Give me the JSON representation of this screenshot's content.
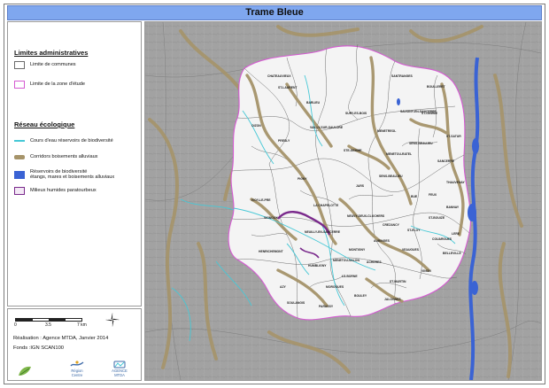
{
  "title": "Trame Bleue",
  "legend": {
    "admin_title": "Limites administratives",
    "admin_items": [
      {
        "label": "Limite de communes",
        "color": "#6b6b6b"
      },
      {
        "label": "Limite de la zone d'étude",
        "color": "#d55bd2"
      }
    ],
    "eco_title": "Réseau écologique",
    "eco_items": [
      {
        "label": "Cours d'eau réservoirs de biodiversité",
        "color": "#46c8d6"
      },
      {
        "label": "Corridors boisements alluviaux",
        "color": "#a6946a"
      },
      {
        "label": "Réservoirs de biodiversité\nétangs, mares et boisements alluviaux",
        "color": "#3a63d4"
      },
      {
        "label": "Milieux humides paratourbeux",
        "color": "#7a2a8c"
      }
    ]
  },
  "scale": {
    "ticks": [
      "0",
      "3.5",
      "7 km"
    ]
  },
  "credits": {
    "realisation": "Réalisation : Agence MTDA, Janvier 2014",
    "fonds": "Fonds :IGN SCAN100"
  },
  "logos": [
    {
      "name": "Région Centre",
      "text": "Région\nCentre"
    },
    {
      "name": "Agence MTDA",
      "text": "AGENCE\nMTDA"
    }
  ],
  "map": {
    "communes": [
      "CHATEAUVIEUX",
      "ST-LAURENT",
      "BARLIEU",
      "SANTRANGES",
      "BOULLERET",
      "LA CHAPELOTTE",
      "IVOY-LE-PRE",
      "OIZON",
      "VAILLY-SUR-SAULDRE",
      "SURY-ES-BOIS",
      "ST-SATUR",
      "SANCERRE",
      "MENETOU-RATEL",
      "HENRICHEMONT",
      "NEUVY-DEUX-CLOCHERS",
      "NEUILLY-EN-SANCERRE",
      "JARS",
      "BUE",
      "CREZANCY",
      "VEAUGUES",
      "HUMBLIGNY",
      "MONTIGNY",
      "ST-BOUIZE",
      "SENS-BEAUJEU",
      "STE-GEMME",
      "THAUVENAY",
      "VINON",
      "SAVIGNY-EN-SANCERRE",
      "MENETREOL",
      "ST-GEMME",
      "PRESLY",
      "ACHERES",
      "AZY",
      "MOROGUES",
      "BOULEY",
      "SOULANGIS",
      "ST-MARTIN",
      "PARASSY",
      "LA BORNE",
      "BELLEVILLE",
      "LERE",
      "COUARGUES",
      "ST-ELOY",
      "AUBINGES",
      "PIGNY",
      "VIGNOUX",
      "MENETOU-SALON",
      "JALOGNES",
      "SENS-BEAUJEU",
      "FEUX",
      "BANNAY"
    ]
  }
}
